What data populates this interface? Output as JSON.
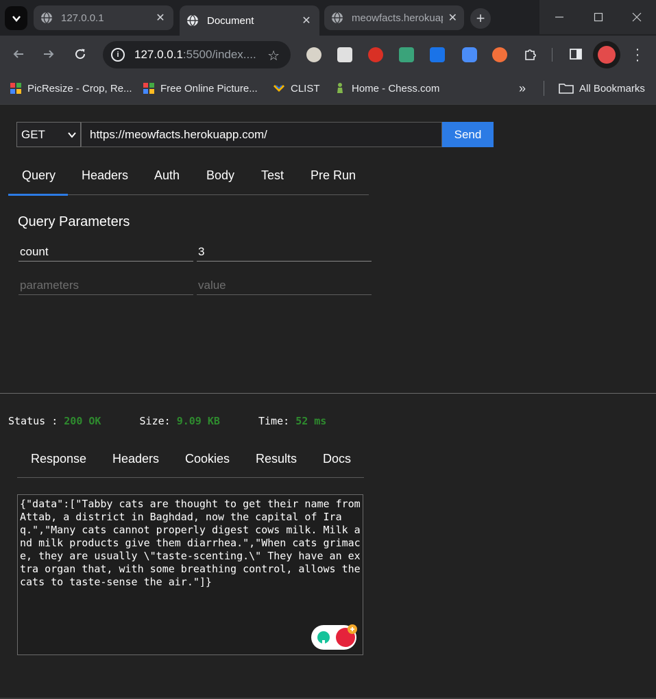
{
  "browser": {
    "tabs": [
      {
        "title": "127.0.0.1",
        "active": false
      },
      {
        "title": "Document",
        "active": true
      },
      {
        "title": "meowfacts.herokuapp.com",
        "active": false
      }
    ],
    "close_glyph": "✕",
    "new_tab_glyph": "+",
    "omnibox": {
      "host": "127.0.0.1",
      "path": ":5500/index....",
      "info_glyph": "i"
    },
    "bookmarks": [
      {
        "label": "PicResize - Crop, Re..."
      },
      {
        "label": "Free Online Picture..."
      },
      {
        "label": "CLIST"
      },
      {
        "label": "Home - Chess.com"
      }
    ],
    "bookmarks_overflow": "»",
    "all_bookmarks": "All Bookmarks"
  },
  "request": {
    "method": "GET",
    "url": "https://meowfacts.herokuapp.com/",
    "send_label": "Send",
    "tabs": [
      "Query",
      "Headers",
      "Auth",
      "Body",
      "Test",
      "Pre Run"
    ],
    "active_tab": "Query"
  },
  "query": {
    "title": "Query Parameters",
    "rows": [
      {
        "key": "count",
        "value": "3"
      }
    ],
    "placeholders": {
      "key": "parameters",
      "value": "value"
    }
  },
  "status": {
    "status_label": "Status :",
    "status_value": "200 OK",
    "size_label": "Size:",
    "size_value": "9.09 KB",
    "time_label": "Time:",
    "time_value": "52 ms"
  },
  "response": {
    "tabs": [
      "Response",
      "Headers",
      "Cookies",
      "Results",
      "Docs"
    ],
    "body": "{\"data\":[\"Tabby cats are thought to get their name from Attab, a district in Baghdad, now the capital of Iraq.\",\"Many cats cannot properly digest cows milk. Milk and milk products give them diarrhea.\",\"When cats grimace, they are usually \\\"taste-scenting.\\\" They have an extra organ that, with some breathing control, allows the cats to taste-sense the air.\"]}"
  },
  "colors": {
    "accent": "#2c7be5",
    "status_green": "#2e8b2e",
    "background": "#222222"
  }
}
